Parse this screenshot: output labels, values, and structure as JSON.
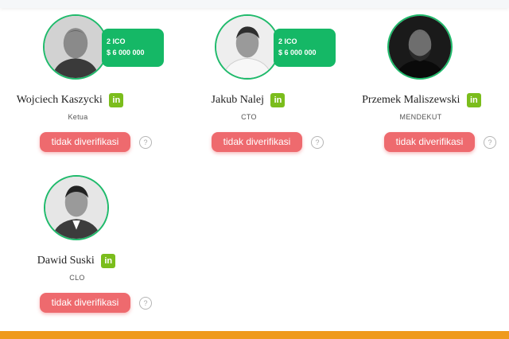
{
  "colors": {
    "accent_green": "#15b866",
    "unverified_red": "#ee6a6e",
    "linkedin_green": "#7bbd1c",
    "footer_orange": "#ef9a1d"
  },
  "team": [
    {
      "name": "Wojciech Kaszycki",
      "role": "Ketua",
      "ico_count": "2 ICO",
      "ico_amount": "$ 6 000 000",
      "status": "tidak diverifikasi",
      "help": "?"
    },
    {
      "name": "Jakub Nalej",
      "role": "CTO",
      "ico_count": "2 ICO",
      "ico_amount": "$ 6 000 000",
      "status": "tidak diverifikasi",
      "help": "?"
    },
    {
      "name": "Przemek Maliszewski",
      "role": "MENDEKUT",
      "status": "tidak diverifikasi",
      "help": "?"
    },
    {
      "name": "Dawid Suski",
      "role": "CLO",
      "status": "tidak diverifikasi",
      "help": "?"
    }
  ],
  "icons": {
    "linkedin": "linkedin-icon",
    "help": "question-circle-icon"
  }
}
